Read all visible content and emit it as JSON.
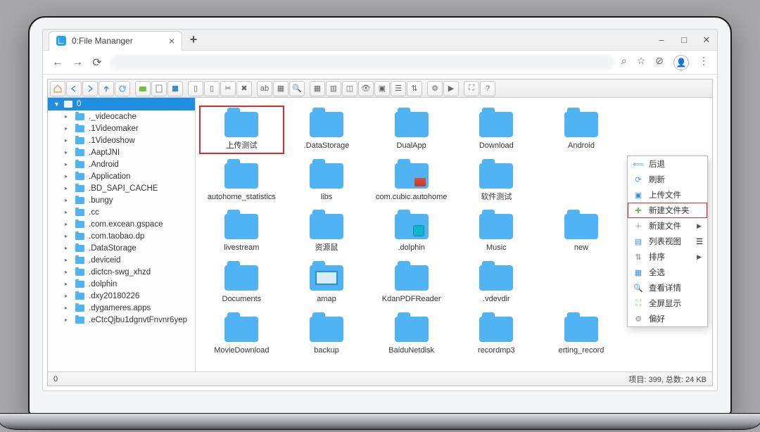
{
  "browser": {
    "tab_title": "0:File Mananger",
    "newtab": "+",
    "close": "×",
    "win_min": "–",
    "win_max": "□",
    "win_close": "✕",
    "nav_back": "←",
    "nav_fwd": "→",
    "reload": "⟳",
    "search_glyph": "⌕",
    "star_glyph": "☆",
    "tag_glyph": "⊘",
    "menu_glyph": "⋮"
  },
  "tree": {
    "root": "0",
    "items": [
      "._videocache",
      ".1Videomaker",
      ".1Videoshow",
      ".AaptJNI",
      ".Android",
      ".Application",
      ".BD_SAPI_CACHE",
      ".bungy",
      ".cc",
      ".com.excean.gspace",
      ".com.taobao.dp",
      ".DataStorage",
      ".deviceid",
      ".dictcn-swg_xhzd",
      ".dolphin",
      ".dxy20180226",
      ".dygameres.apps",
      ".eCtcQjbu1dgnvtFnvnr6yep"
    ]
  },
  "grid": [
    {
      "name": "上传测试",
      "sel": true
    },
    {
      "name": ".DataStorage"
    },
    {
      "name": "DualApp"
    },
    {
      "name": "Download"
    },
    {
      "name": "Android"
    },
    {
      "name": ""
    },
    {
      "name": "autohome_statistics"
    },
    {
      "name": "libs"
    },
    {
      "name": "com.cubic.autohome",
      "ov": "overlay"
    },
    {
      "name": "软件测试"
    },
    {
      "name": ""
    },
    {
      "name": ""
    },
    {
      "name": "livestream"
    },
    {
      "name": "资源鼠"
    },
    {
      "name": ".dolphin",
      "ov": "overlay2"
    },
    {
      "name": "Music"
    },
    {
      "name": "new"
    },
    {
      "name": ""
    },
    {
      "name": "Documents"
    },
    {
      "name": "amap",
      "ov": "overlay3"
    },
    {
      "name": "KdanPDFReader"
    },
    {
      "name": ".vdevdir"
    },
    {
      "name": ""
    },
    {
      "name": ""
    },
    {
      "name": "MovieDownload"
    },
    {
      "name": "backup"
    },
    {
      "name": "BaiduNetdisk"
    },
    {
      "name": "recordmp3"
    },
    {
      "name": "erting_record"
    },
    {
      "name": ""
    }
  ],
  "ctx": [
    {
      "ico": "⟸",
      "label": "后退",
      "col": "#4aa3e6"
    },
    {
      "ico": "⟳",
      "label": "刷新",
      "col": "#4aa3e6"
    },
    {
      "ico": "▣",
      "label": "上传文件",
      "col": "#3a8ed0"
    },
    {
      "ico": "✚",
      "label": "新建文件夹",
      "col": "#6fbf4b",
      "hl": true
    },
    {
      "ico": "＋",
      "label": "新建文件",
      "col": "#888",
      "sub": true
    },
    {
      "ico": "▤",
      "label": "列表视图",
      "col": "#3a8ed0",
      "toggle": true
    },
    {
      "ico": "⇅",
      "label": "排序",
      "col": "#888",
      "sub": true
    },
    {
      "ico": "▦",
      "label": "全选",
      "col": "#3a8ed0"
    },
    {
      "ico": "🔍",
      "label": "查看详情",
      "col": "#888"
    },
    {
      "ico": "⛶",
      "label": "全屏显示",
      "col": "#6fbf4b"
    },
    {
      "ico": "⚙",
      "label": "偏好",
      "col": "#888"
    }
  ],
  "status": {
    "left": "0",
    "right": "项目: 399, 总数: 24 KB"
  }
}
